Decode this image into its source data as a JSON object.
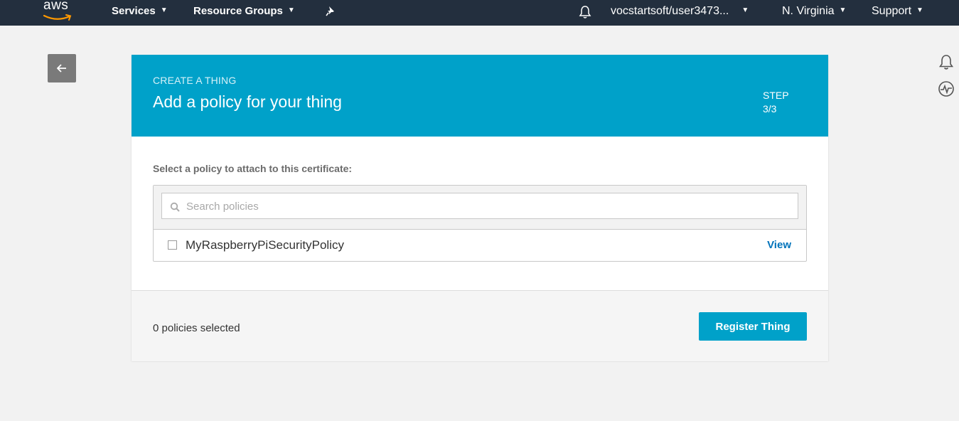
{
  "nav": {
    "logo_text": "aws",
    "services_label": "Services",
    "resource_groups_label": "Resource Groups",
    "pin_icon": "pin-icon",
    "bell_icon": "bell-icon",
    "account_label": "vocstartsoft/user3473...",
    "region_label": "N. Virginia",
    "support_label": "Support",
    "background_color": "#232f3e"
  },
  "back_icon": "arrow-left-icon",
  "side_icons": [
    "bell-icon",
    "pulse-icon"
  ],
  "wizard": {
    "eyebrow": "CREATE A THING",
    "title": "Add a policy for your thing",
    "step_label": "STEP",
    "step_value": "3/3",
    "header_color": "#00a1c9",
    "select_label": "Select a policy to attach to this certificate:",
    "search_placeholder": "Search policies",
    "policies": [
      {
        "name": "MyRaspberryPiSecurityPolicy",
        "checked": false,
        "view_label": "View"
      }
    ],
    "selected_count_text": "0 policies selected",
    "register_button": "Register Thing"
  }
}
